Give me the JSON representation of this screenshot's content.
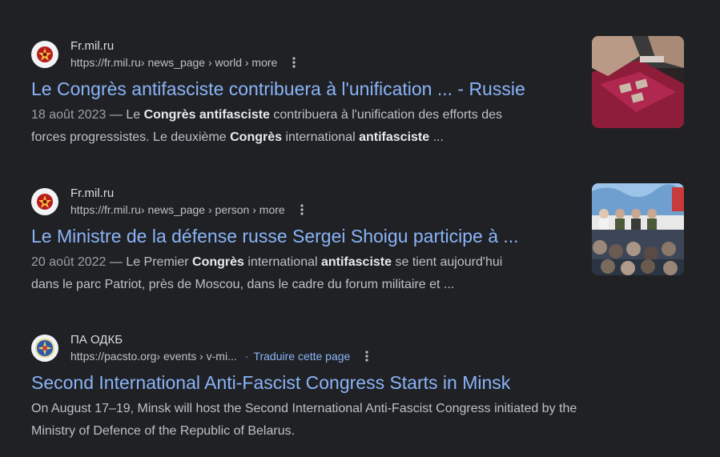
{
  "results": [
    {
      "site_name": "Fr.mil.ru",
      "url_parts": [
        "https://fr.mil.ru",
        " › news_page › world › more"
      ],
      "title": "Le Congrès antifasciste contribuera à l'unification ... - Russie",
      "date": "18 août 2023",
      "snippet_line1": [
        {
          "t": " — Le ",
          "b": false
        },
        {
          "t": "Congrès antifasciste",
          "b": true
        },
        {
          "t": " contribuera à l'unification des efforts des",
          "b": false
        }
      ],
      "snippet_line2": [
        {
          "t": "forces progressistes. Le deuxième ",
          "b": false
        },
        {
          "t": "Congrès",
          "b": true
        },
        {
          "t": " international ",
          "b": false
        },
        {
          "t": "antifasciste",
          "b": true
        },
        {
          "t": " ...",
          "b": false
        }
      ],
      "thumbnail_icon": "award-box-photo"
    },
    {
      "site_name": "Fr.mil.ru",
      "url_parts": [
        "https://fr.mil.ru",
        " › news_page › person › more"
      ],
      "title": "Le Ministre de la défense russe Sergei Shoigu participe à ...",
      "date": "20 août 2022",
      "snippet_line1": [
        {
          "t": " — Le Premier ",
          "b": false
        },
        {
          "t": "Congrès",
          "b": true
        },
        {
          "t": " international ",
          "b": false
        },
        {
          "t": "antifasciste",
          "b": true
        },
        {
          "t": " se tient aujourd'hui",
          "b": false
        }
      ],
      "snippet_line2": [
        {
          "t": "dans le parc Patriot, près de Moscou, dans le cadre du forum militaire et ...",
          "b": false
        }
      ],
      "thumbnail_icon": "conference-photo"
    },
    {
      "site_name": "ПА ОДКБ",
      "url_parts": [
        "https://pacsto.org",
        " › events › v-mi..."
      ],
      "translate_label": "Traduire cette page",
      "title": "Second International Anti-Fascist Congress Starts in Minsk",
      "snippet_line1_plain": "On August 17–19, Minsk will host the Second International Anti-Fascist Congress initiated by the",
      "snippet_line2_plain": "Ministry of Defence of the Republic of Belarus."
    }
  ],
  "colors": {
    "background": "#202124",
    "link": "#8ab4f8",
    "text": "#bdc1c6",
    "bold": "#e8eaed"
  }
}
